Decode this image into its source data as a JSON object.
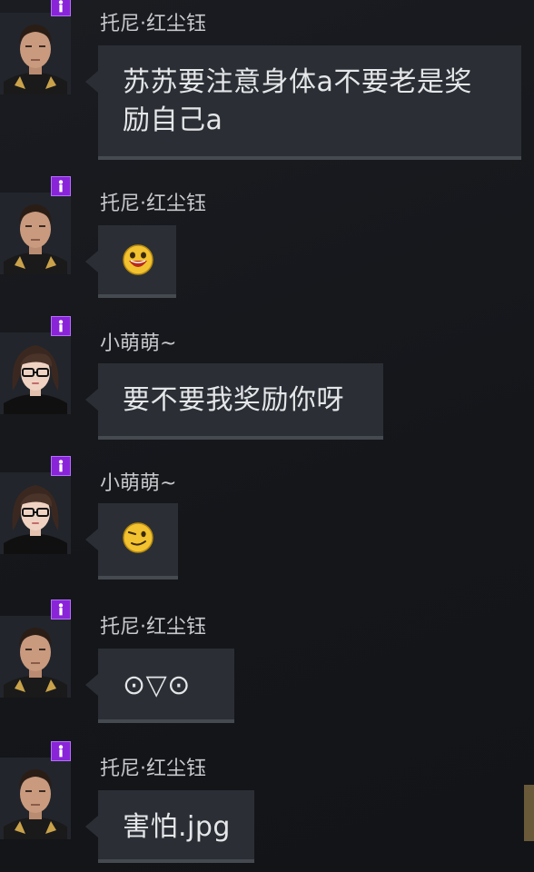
{
  "messages": [
    {
      "sender": "托尼·红尘钰",
      "avatar": "male-avatar",
      "text": "苏苏要注意身体a不要老是奖励自己a"
    },
    {
      "sender": "托尼·红尘钰",
      "avatar": "male-avatar",
      "emoji": "grin-emoji"
    },
    {
      "sender": "小萌萌~",
      "avatar": "female-avatar",
      "text": "要不要我奖励你呀"
    },
    {
      "sender": "小萌萌~",
      "avatar": "female-avatar",
      "emoji": "wink-emoji"
    },
    {
      "sender": "托尼·红尘钰",
      "avatar": "male-avatar",
      "text": "⊙▽⊙"
    },
    {
      "sender": "托尼·红尘钰",
      "avatar": "male-avatar",
      "text": "害怕.jpg"
    }
  ],
  "colors": {
    "background": "#15171b",
    "bubble": "#2b2f35",
    "badge": "#8a24d8",
    "name_text": "#c7c9cc",
    "message_text": "#e4e6e8"
  }
}
